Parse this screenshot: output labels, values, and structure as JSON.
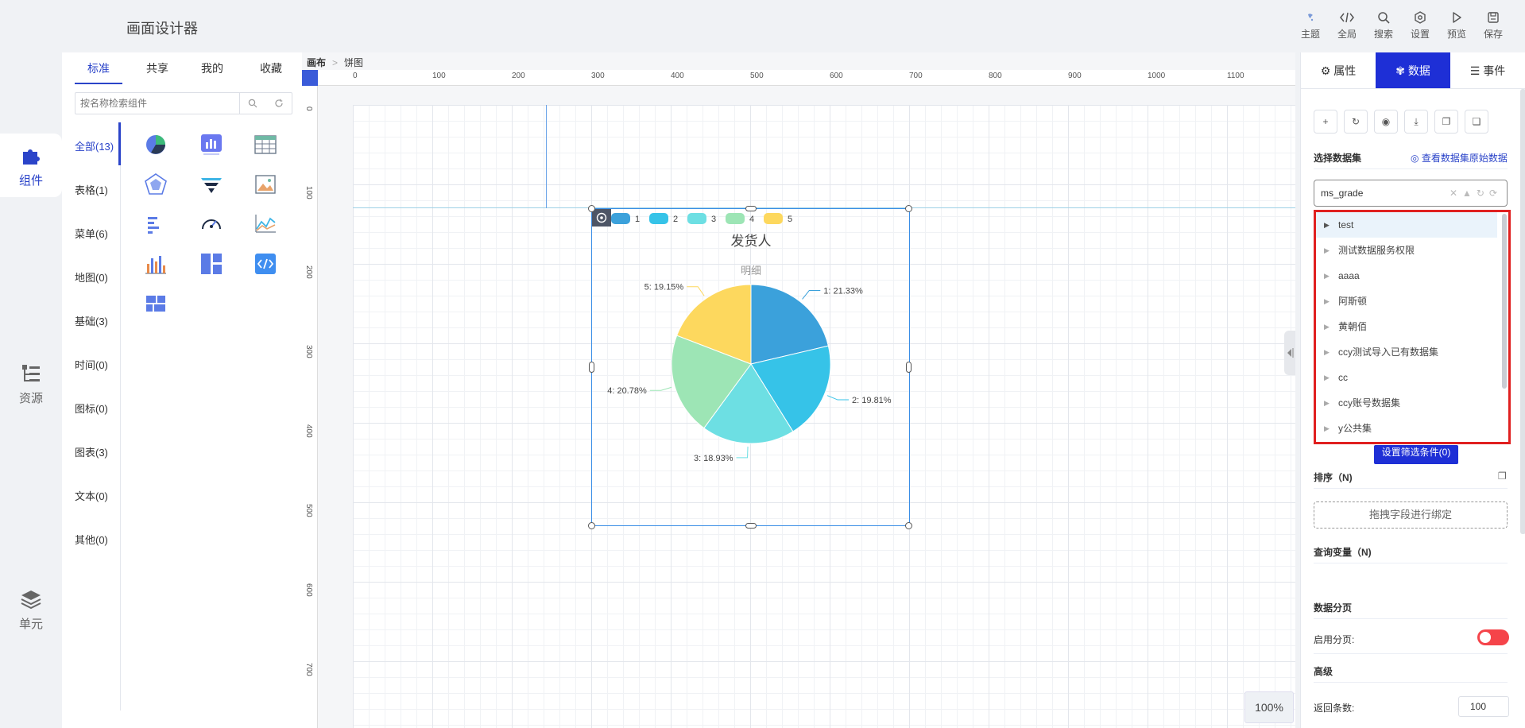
{
  "app": {
    "title": "画面设计器"
  },
  "toolbar": [
    {
      "label": "主题",
      "icon": "theme-icon"
    },
    {
      "label": "全局",
      "icon": "code-icon"
    },
    {
      "label": "搜索",
      "icon": "search-icon"
    },
    {
      "label": "设置",
      "icon": "gear-icon"
    },
    {
      "label": "预览",
      "icon": "play-icon"
    },
    {
      "label": "保存",
      "icon": "save-icon"
    }
  ],
  "rail": [
    {
      "label": "组件",
      "icon": "puzzle-icon",
      "active": true
    },
    {
      "label": "资源",
      "icon": "tree-icon"
    },
    {
      "label": "单元",
      "icon": "layers-icon"
    }
  ],
  "components": {
    "tabs": [
      "标准",
      "共享",
      "我的",
      "收藏"
    ],
    "search_placeholder": "按名称检索组件",
    "categories": [
      "全部(13)",
      "表格(1)",
      "菜单(6)",
      "地图(0)",
      "基础(3)",
      "时间(0)",
      "图标(0)",
      "图表(3)",
      "文本(0)",
      "其他(0)"
    ],
    "icons": [
      "pie-chart-icon",
      "bar-chart-icon",
      "table-icon",
      "radar-chart-icon",
      "funnel-chart-icon",
      "image-icon",
      "horizontal-bar-icon",
      "gauge-icon",
      "line-chart-icon",
      "column-chart-icon",
      "layout-icon",
      "embed-code-icon",
      "grid-layout-icon"
    ]
  },
  "canvas": {
    "breadcrumb": [
      "画布",
      "饼图"
    ],
    "ruler_top": [
      "0",
      "100",
      "200",
      "300",
      "400",
      "500",
      "600",
      "700",
      "800",
      "900",
      "1000",
      "1100"
    ],
    "ruler_left": [
      "0",
      "100",
      "200",
      "300",
      "400",
      "500",
      "600",
      "700"
    ],
    "zoom": "100%"
  },
  "chart_data": {
    "type": "pie",
    "title": "发货人",
    "subtitle": "明细",
    "categories": [
      "1",
      "2",
      "3",
      "4",
      "5"
    ],
    "values": [
      21.33,
      19.81,
      18.93,
      20.78,
      19.15
    ],
    "labels": [
      "1: 21.33%",
      "2: 19.81%",
      "3: 18.93%",
      "4: 20.78%",
      "5: 19.15%"
    ],
    "colors": [
      "#3ba1db",
      "#36c3e8",
      "#6ddfe3",
      "#9de5b5",
      "#fdd85e"
    ],
    "legend": "top-left"
  },
  "right_panel": {
    "tabs": [
      {
        "label": "属性",
        "icon": "gear-icon"
      },
      {
        "label": "数据",
        "icon": "data-icon",
        "active": true
      },
      {
        "label": "事件",
        "icon": "list-icon"
      }
    ],
    "dataset_title": "选择数据集",
    "dataset_link": "查看数据集原始数据",
    "dataset_value": "ms_grade",
    "dataset_options": [
      "test",
      "测试数据服务权限",
      "aaaa",
      "阿斯顿",
      "黄朝佰",
      "ccy测试导入已有数据集",
      "cc",
      "ccy账号数据集",
      "y公共集"
    ],
    "filter_button": "设置筛选条件(0)",
    "sort_title": "排序（N)",
    "bind_hint": "拖拽字段进行绑定",
    "query_var_title": "查询变量（N)",
    "paging_title": "数据分页",
    "paging_label": "启用分页:",
    "advanced_title": "高级",
    "return_label": "返回条数:",
    "return_value": "100"
  }
}
